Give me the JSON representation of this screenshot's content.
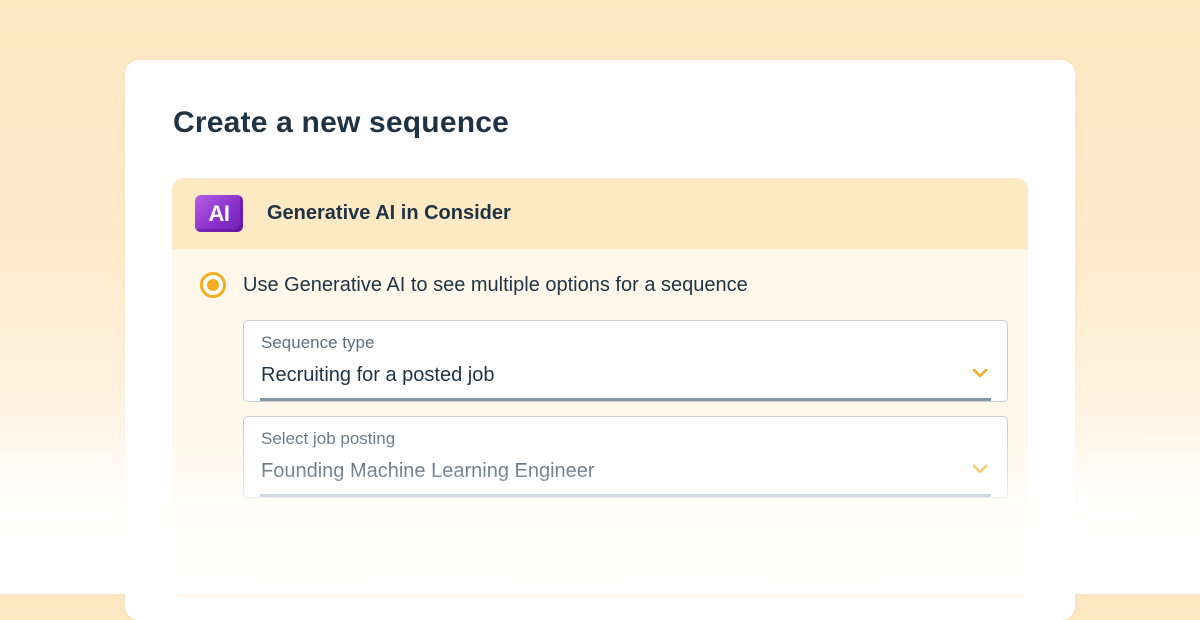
{
  "dialog": {
    "title": "Create a new sequence"
  },
  "ai_section": {
    "badge_text": "AI",
    "header_label": "Generative AI in Consider",
    "option_label": "Use Generative AI to see multiple options for a sequence",
    "option_selected": true
  },
  "fields": [
    {
      "label": "Sequence type",
      "value": "Recruiting for a posted job",
      "icon": "chevron-down-icon"
    },
    {
      "label": "Select job posting",
      "value": "Founding Machine Learning Engineer",
      "icon": "chevron-down-icon"
    }
  ],
  "colors": {
    "accent": "#f2ad21",
    "ai_badge": "#8b32cc",
    "text_primary": "#1f3344",
    "header_band": "#fde9c4"
  }
}
